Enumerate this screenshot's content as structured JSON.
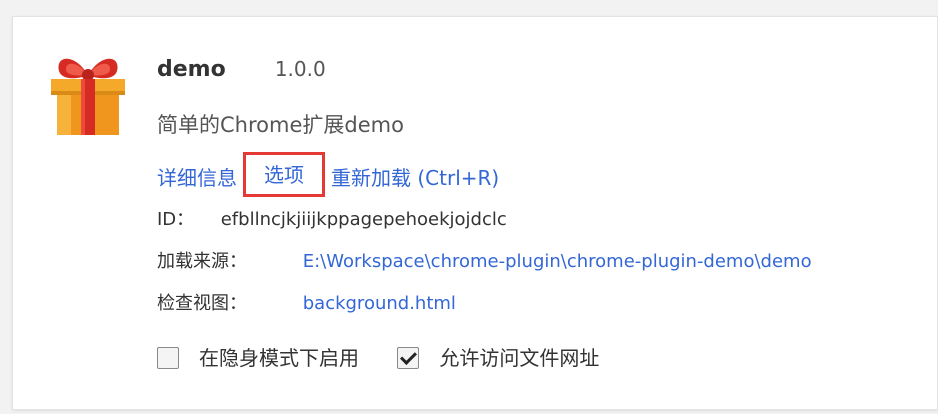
{
  "extension": {
    "name": "demo",
    "version": "1.0.0",
    "description": "简单的Chrome扩展demo",
    "icon": "gift-icon"
  },
  "links": {
    "details": "详细信息",
    "options": "选项",
    "reload": "重新加载 (Ctrl+R)"
  },
  "meta": {
    "id_label": "ID：",
    "id_value": "efbllncjkjiijkppagepehoekjojdclc",
    "source_label": "加载来源：",
    "source_value": "E:\\Workspace\\chrome-plugin\\chrome-plugin-demo\\demo",
    "view_label": "检查视图：",
    "view_value": "background.html"
  },
  "checkboxes": {
    "incognito": {
      "label": "在隐身模式下启用",
      "checked": false
    },
    "file_access": {
      "label": "允许访问文件网址",
      "checked": true
    }
  },
  "colors": {
    "link": "#3367d6",
    "highlight": "#e53935"
  }
}
